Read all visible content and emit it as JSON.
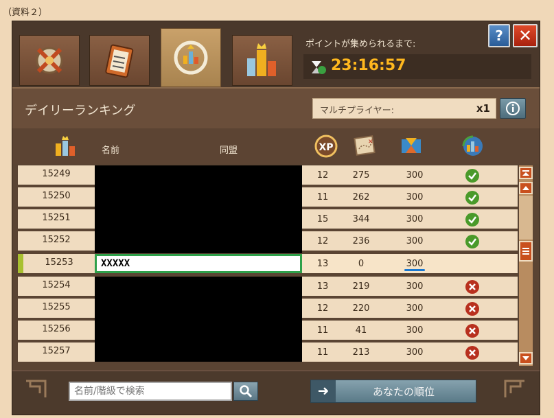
{
  "caption": "（資料２）",
  "tabs": [
    {
      "name": "tab-battle",
      "icon": "crossed-swords-icon",
      "active": false
    },
    {
      "name": "tab-quests",
      "icon": "clipboard-icon",
      "active": false
    },
    {
      "name": "tab-daily-ranking",
      "icon": "rotating-ranking-icon",
      "active": true
    },
    {
      "name": "tab-overall-ranking",
      "icon": "bar-chart-crown-icon",
      "active": false
    }
  ],
  "timer": {
    "label": "ポイントが集められるまで:",
    "value": "23:16:57"
  },
  "buttons": {
    "help": "?",
    "close": "✕"
  },
  "ranking": {
    "title": "デイリーランキング",
    "multiplier_label": "マルチプライヤー:",
    "multiplier_value": "x1"
  },
  "columns": {
    "rank_icon": "crown-bars-icon",
    "name": "名前",
    "alliance": "同盟",
    "xp_icon": "xp-icon",
    "map_icon": "treasure-map-icon",
    "time_icon": "hourglass-icon",
    "status_icon": "globe-refresh-icon"
  },
  "rows": [
    {
      "rank": "15249",
      "xp": "12",
      "map": "275",
      "time": "300",
      "status": "check"
    },
    {
      "rank": "15250",
      "xp": "11",
      "map": "262",
      "time": "300",
      "status": "check"
    },
    {
      "rank": "15251",
      "xp": "15",
      "map": "344",
      "time": "300",
      "status": "check"
    },
    {
      "rank": "15252",
      "xp": "12",
      "map": "236",
      "time": "300",
      "status": "check"
    },
    {
      "rank": "15253",
      "xp": "13",
      "map": "0",
      "time": "300",
      "status": "none",
      "name": "XXXXX",
      "mine": true
    },
    {
      "rank": "15254",
      "xp": "13",
      "map": "219",
      "time": "300",
      "status": "cross"
    },
    {
      "rank": "15255",
      "xp": "12",
      "map": "220",
      "time": "300",
      "status": "cross"
    },
    {
      "rank": "15256",
      "xp": "11",
      "map": "41",
      "time": "300",
      "status": "cross"
    },
    {
      "rank": "15257",
      "xp": "11",
      "map": "213",
      "time": "300",
      "status": "cross"
    }
  ],
  "footer": {
    "search_placeholder": "名前/階級で検索",
    "your_rank_label": "あなたの順位",
    "arrow": "➜"
  },
  "colors": {
    "panel": "#5a4433",
    "row_bg": "#f0dcc0",
    "timer": "#ffb81e",
    "check": "#4a9a2a",
    "cross": "#b8301e",
    "highlight_border": "#2ea04a"
  }
}
